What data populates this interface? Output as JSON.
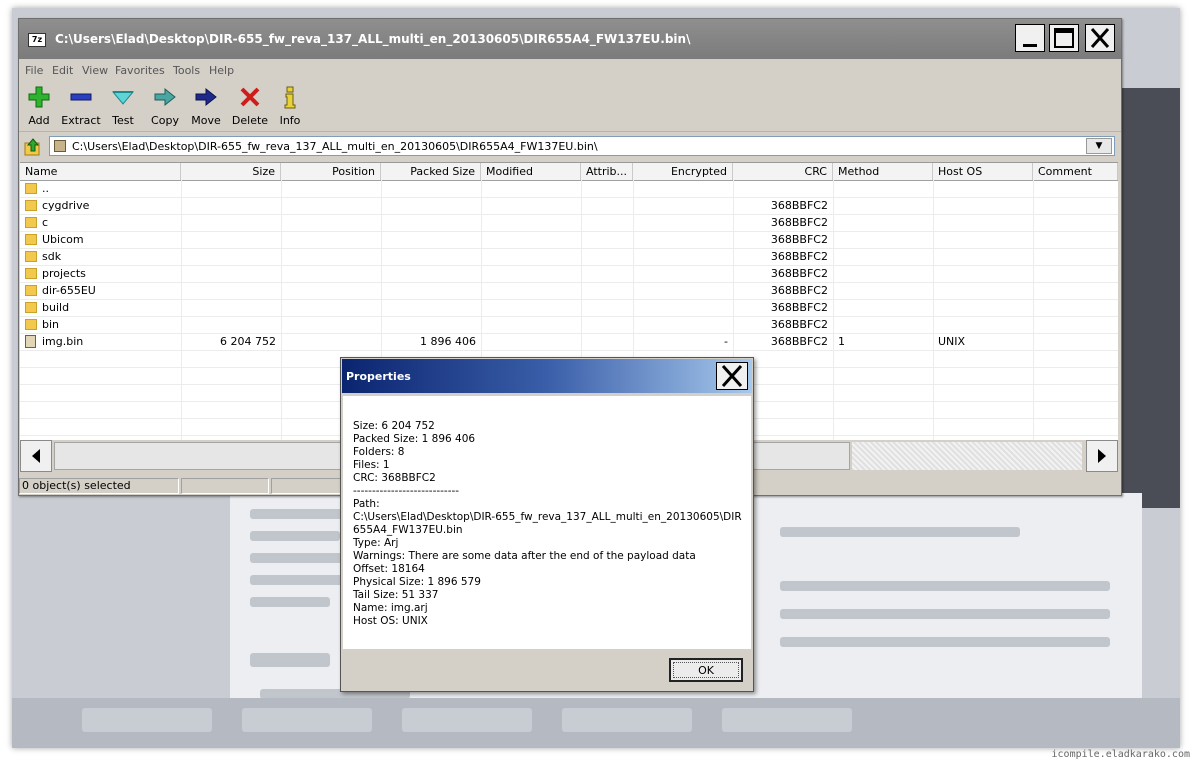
{
  "window": {
    "title": "C:\\Users\\Elad\\Desktop\\DIR-655_fw_reva_137_ALL_multi_en_20130605\\DIR655A4_FW137EU.bin\\",
    "icon_label": "7z",
    "controls": [
      "minimize-icon",
      "maximize-icon",
      "close-icon"
    ]
  },
  "menu": [
    "File",
    "Edit",
    "View",
    "Favorites",
    "Tools",
    "Help"
  ],
  "toolbar": {
    "add": "Add",
    "extract": "Extract",
    "test": "Test",
    "copy": "Copy",
    "move": "Move",
    "delete": "Delete",
    "info": "Info"
  },
  "address": {
    "path": "C:\\Users\\Elad\\Desktop\\DIR-655_fw_reva_137_ALL_multi_en_20130605\\DIR655A4_FW137EU.bin\\"
  },
  "columns": [
    "Name",
    "Size",
    "Position",
    "Packed Size",
    "Modified",
    "Attrib...",
    "Encrypted",
    "CRC",
    "Method",
    "Host OS",
    "Comment"
  ],
  "rows": [
    {
      "name": "..",
      "type": "folder",
      "size": "",
      "packed": "",
      "encrypted": "",
      "crc": "",
      "method": "",
      "host": ""
    },
    {
      "name": "cygdrive",
      "type": "folder",
      "size": "",
      "packed": "",
      "encrypted": "",
      "crc": "368BBFC2",
      "method": "",
      "host": ""
    },
    {
      "name": "c",
      "type": "folder",
      "size": "",
      "packed": "",
      "encrypted": "",
      "crc": "368BBFC2",
      "method": "",
      "host": ""
    },
    {
      "name": "Ubicom",
      "type": "folder",
      "size": "",
      "packed": "",
      "encrypted": "",
      "crc": "368BBFC2",
      "method": "",
      "host": ""
    },
    {
      "name": "sdk",
      "type": "folder",
      "size": "",
      "packed": "",
      "encrypted": "",
      "crc": "368BBFC2",
      "method": "",
      "host": ""
    },
    {
      "name": "projects",
      "type": "folder",
      "size": "",
      "packed": "",
      "encrypted": "",
      "crc": "368BBFC2",
      "method": "",
      "host": ""
    },
    {
      "name": "dir-655EU",
      "type": "folder",
      "size": "",
      "packed": "",
      "encrypted": "",
      "crc": "368BBFC2",
      "method": "",
      "host": ""
    },
    {
      "name": "build",
      "type": "folder",
      "size": "",
      "packed": "",
      "encrypted": "",
      "crc": "368BBFC2",
      "method": "",
      "host": ""
    },
    {
      "name": "bin",
      "type": "folder",
      "size": "",
      "packed": "",
      "encrypted": "",
      "crc": "368BBFC2",
      "method": "",
      "host": ""
    },
    {
      "name": "img.bin",
      "type": "file",
      "size": "6 204 752",
      "packed": "1 896 406",
      "encrypted": "-",
      "crc": "368BBFC2",
      "method": "1",
      "host": "UNIX"
    }
  ],
  "status": {
    "selected": "0 object(s) selected"
  },
  "dialog": {
    "title": "Properties",
    "ok": "OK",
    "lines": [
      "Size: 6 204 752",
      "Packed Size: 1 896 406",
      "Folders: 8",
      "Files: 1",
      "CRC: 368BBFC2",
      "----------------------------",
      "Path:",
      "C:\\Users\\Elad\\Desktop\\DIR-655_fw_reva_137_ALL_multi_en_20130605\\DIR",
      "655A4_FW137EU.bin",
      "Type: Arj",
      "Warnings: There are some data after the end of the payload data",
      "Offset: 18164",
      "Physical Size: 1 896 579",
      "Tail Size: 51 337",
      "Name: img.arj",
      "Host OS: UNIX"
    ]
  },
  "watermark": "icompile.eladkarako.com"
}
